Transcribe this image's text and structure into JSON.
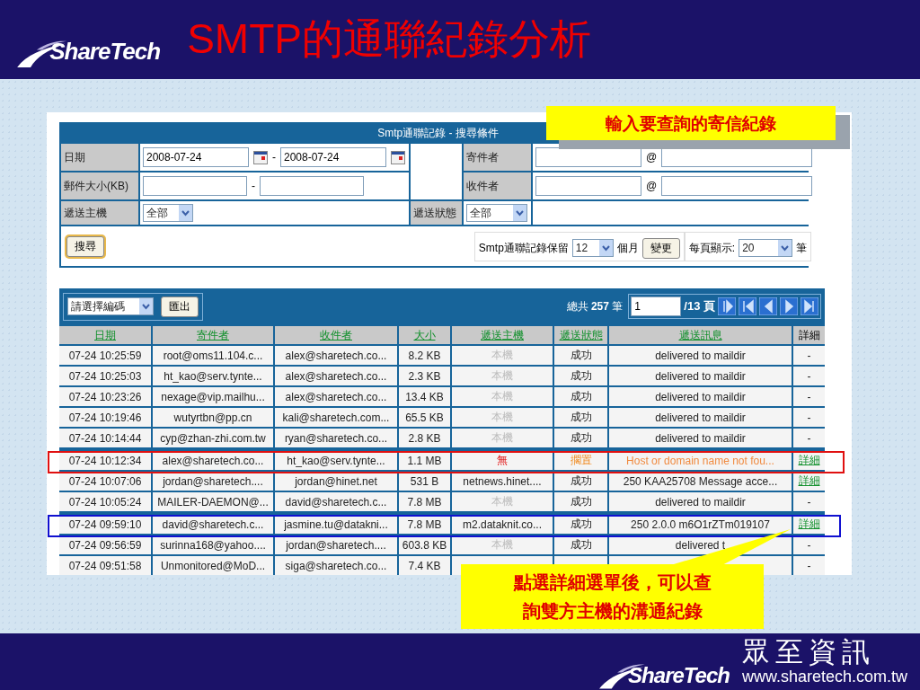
{
  "slide": {
    "logo": "ShareTech",
    "title": "SMTP的通聯紀錄分析"
  },
  "search": {
    "title": "Smtp通聯記錄 - 搜尋條件",
    "date_label": "日期",
    "date_from": "2008-07-24",
    "date_sep": "-",
    "date_to": "2008-07-24",
    "size_label": "郵件大小(KB)",
    "size_sep": "-",
    "sender_label": "寄件者",
    "sender_at": "@",
    "recipient_label": "收件者",
    "recipient_at": "@",
    "host_label": "遞送主機",
    "host_value": "全部",
    "status_label": "遞送狀態",
    "status_value": "全部",
    "search_button": "搜尋",
    "retention_label": "Smtp通聯記錄保留",
    "retention_value": "12",
    "retention_unit": "個月",
    "change_button": "變更",
    "per_page_label": "每頁顯示:",
    "per_page_value": "20",
    "per_page_unit": "筆"
  },
  "callout_top": "輸入要查詢的寄信紀錄",
  "log": {
    "encoding_placeholder": "請選擇編碼",
    "export_button": "匯出",
    "total_prefix": "總共",
    "total": "257",
    "total_unit": "筆",
    "page": "1",
    "page_total": "/13 頁",
    "columns": [
      {
        "label": "日期",
        "sortable": true
      },
      {
        "label": "寄件者",
        "sortable": true
      },
      {
        "label": "收件者",
        "sortable": true
      },
      {
        "label": "大小",
        "sortable": true
      },
      {
        "label": "遞送主機",
        "sortable": true
      },
      {
        "label": "遞送狀態",
        "sortable": true
      },
      {
        "label": "遞送訊息",
        "sortable": true
      },
      {
        "label": "詳細",
        "sortable": false
      }
    ],
    "rows": [
      {
        "date": "07-24 10:25:59",
        "sender": "root@oms11.104.c...",
        "recipient": "alex@sharetech.co...",
        "size": "8.2 KB",
        "host": "本機",
        "kind": "local",
        "status": "成功",
        "message": "delivered to maildir",
        "detail": "-",
        "detail_link": false
      },
      {
        "date": "07-24 10:25:03",
        "sender": "ht_kao@serv.tynte...",
        "recipient": "alex@sharetech.co...",
        "size": "2.3 KB",
        "host": "本機",
        "kind": "local",
        "status": "成功",
        "message": "delivered to maildir",
        "detail": "-",
        "detail_link": false
      },
      {
        "date": "07-24 10:23:26",
        "sender": "nexage@vip.mailhu...",
        "recipient": "alex@sharetech.co...",
        "size": "13.4 KB",
        "host": "本機",
        "kind": "local",
        "status": "成功",
        "message": "delivered to maildir",
        "detail": "-",
        "detail_link": false
      },
      {
        "date": "07-24 10:19:46",
        "sender": "wutyrtbn@pp.cn",
        "recipient": "kali@sharetech.com...",
        "size": "65.5 KB",
        "host": "本機",
        "kind": "local",
        "status": "成功",
        "message": "delivered to maildir",
        "detail": "-",
        "detail_link": false
      },
      {
        "date": "07-24 10:14:44",
        "sender": "cyp@zhan-zhi.com.tw",
        "recipient": "ryan@sharetech.co...",
        "size": "2.8 KB",
        "host": "本機",
        "kind": "local",
        "status": "成功",
        "message": "delivered to maildir",
        "detail": "-",
        "detail_link": false
      },
      {
        "date": "07-24 10:12:34",
        "sender": "alex@sharetech.co...",
        "recipient": "ht_kao@serv.tynte...",
        "size": "1.1 MB",
        "host": "無",
        "kind": "deferred",
        "status": "擱置",
        "message": "Host or domain name not fou...",
        "detail": "詳細",
        "detail_link": true,
        "color": "#e01010"
      },
      {
        "date": "07-24 10:07:06",
        "sender": "jordan@sharetech....",
        "recipient": "jordan@hinet.net",
        "size": "531 B",
        "host": "netnews.hinet....",
        "kind": "relayed",
        "status": "成功",
        "message": "250 KAA25708 Message acce...",
        "detail": "詳細",
        "detail_link": true
      },
      {
        "date": "07-24 10:05:24",
        "sender": "MAILER-DAEMON@...",
        "recipient": "david@sharetech.c...",
        "size": "7.8 MB",
        "host": "本機",
        "kind": "local",
        "status": "成功",
        "message": "delivered to maildir",
        "detail": "-",
        "detail_link": false
      },
      {
        "date": "07-24 09:59:10",
        "sender": "david@sharetech.c...",
        "recipient": "jasmine.tu@datakni...",
        "size": "7.8 MB",
        "host": "m2.dataknit.co...",
        "kind": "relayed",
        "status": "成功",
        "message": "250 2.0.0 m6O1rZTm019107",
        "detail": "詳細",
        "detail_link": true,
        "color": "#1010d0"
      },
      {
        "date": "07-24 09:56:59",
        "sender": "surinna168@yahoo....",
        "recipient": "jordan@sharetech....",
        "size": "603.8 KB",
        "host": "本機",
        "kind": "local",
        "status": "成功",
        "message": "delivered t",
        "detail": "-",
        "detail_link": false
      },
      {
        "date": "07-24 09:51:58",
        "sender": "Unmonitored@MoD...",
        "recipient": "siga@sharetech.co...",
        "size": "7.4 KB",
        "detail": "-",
        "detail_link": false
      }
    ]
  },
  "callout_bottom": "點選詳細選單後，可以查詢雙方主機的溝通紀錄",
  "footer": {
    "logo": "ShareTech",
    "company": "眾至資訊",
    "url": "www.sharetech.com.tw"
  }
}
